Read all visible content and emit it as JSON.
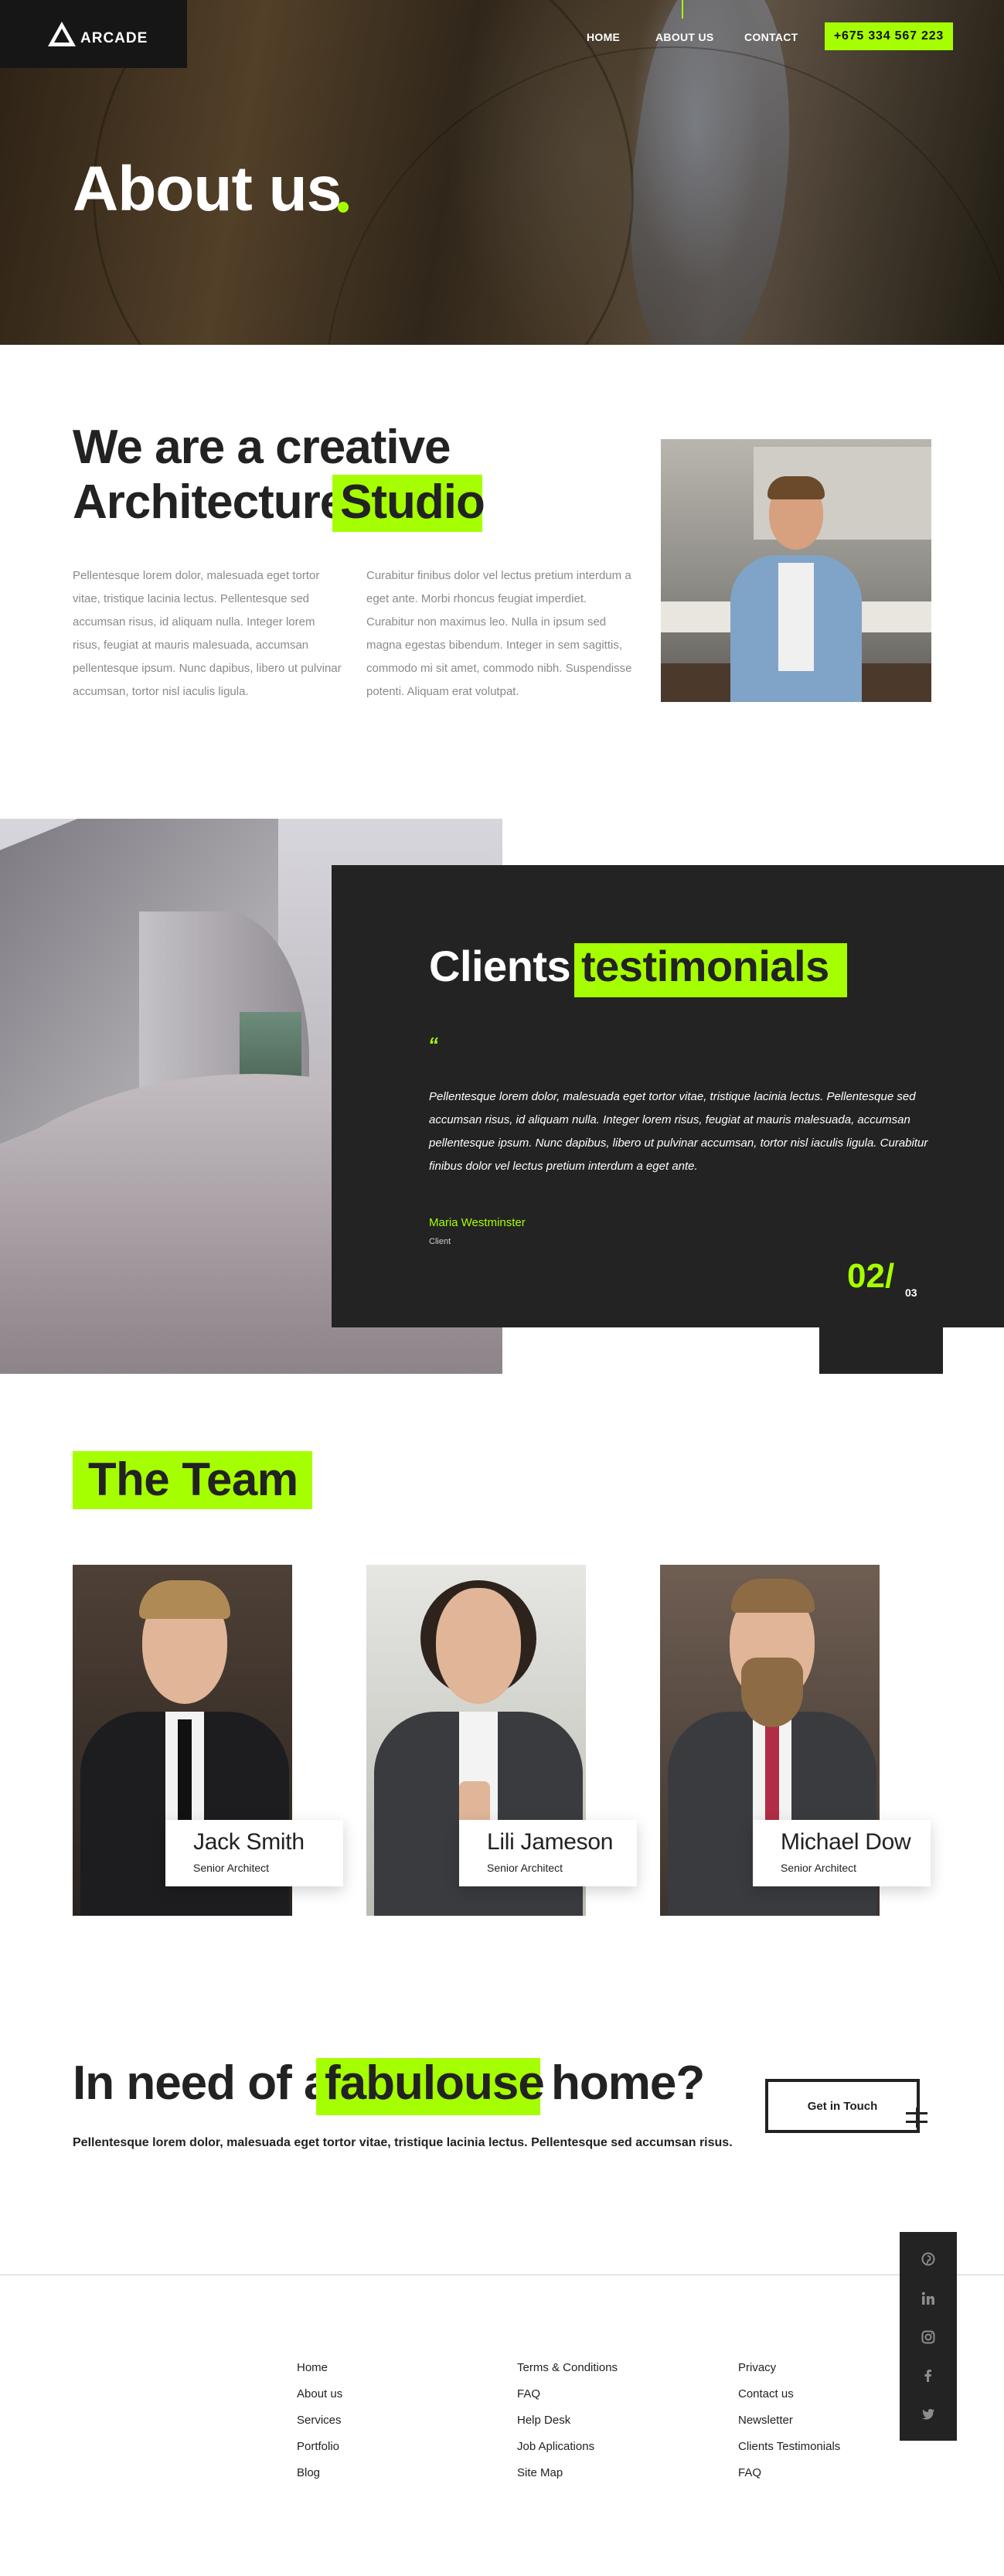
{
  "header": {
    "logo_text": "ARCADE",
    "nav": [
      "HOME",
      "ABOUT US",
      "CONTACT"
    ],
    "phone": "+675 334 567 223",
    "accent": "#a6ff00"
  },
  "hero": {
    "title": "About us"
  },
  "studio": {
    "heading_line1": "We are a creative",
    "heading_line2": "Architecture",
    "heading_highlight": "Studio",
    "para1": "Pellentesque lorem dolor, malesuada eget tortor vitae, tristique lacinia lectus. Pellentesque sed accumsan risus, id aliquam nulla. Integer lorem risus, feugiat at mauris malesuada, accumsan pellentesque ipsum. Nunc dapibus, libero ut pulvinar accumsan, tortor nisl iaculis ligula.",
    "para2": "Curabitur finibus dolor vel lectus pretium interdum a eget ante. Morbi rhoncus feugiat imperdiet. Curabitur non maximus leo. Nulla in ipsum sed magna egestas bibendum. Integer in sem sagittis, commodo mi sit amet, commodo nibh. Suspendisse potenti. Aliquam erat volutpat."
  },
  "testimonials": {
    "heading": "Clients",
    "heading_highlight": "testimonials",
    "quote_mark": "“",
    "text": "Pellentesque lorem dolor, malesuada eget tortor vitae, tristique lacinia lectus. Pellentesque sed accumsan risus, id aliquam nulla. Integer lorem risus, feugiat at mauris malesuada, accumsan pellentesque ipsum. Nunc dapibus, libero ut pulvinar accumsan, tortor nisl iaculis ligula. Curabitur finibus dolor vel lectus pretium interdum a eget ante.",
    "author": "Maria Westminster",
    "role": "Client",
    "current": "02/",
    "total": "03"
  },
  "team": {
    "title": "The Team",
    "members": [
      {
        "name": "Jack Smith",
        "role": "Senior Architect"
      },
      {
        "name": "Lili Jameson",
        "role": "Senior Architect"
      },
      {
        "name": "Michael Dow",
        "role": "Senior Architect"
      }
    ]
  },
  "cta": {
    "pre": "In need of a",
    "highlight": "fabulouse",
    "post": "home?",
    "subtitle": "Pellentesque lorem dolor, malesuada eget tortor vitae, tristique lacinia lectus. Pellentesque sed accumsan risus.",
    "button": "Get in Touch"
  },
  "social": [
    "pinterest-icon",
    "linkedin-icon",
    "instagram-icon",
    "facebook-icon",
    "twitter-icon"
  ],
  "footer": {
    "col1": [
      "Home",
      "About us",
      "Services",
      "Portfolio",
      "Blog"
    ],
    "col2": [
      "Terms & Conditions",
      "FAQ",
      "Help Desk",
      "Job Aplications",
      "Site Map"
    ],
    "col3": [
      "Privacy",
      "Contact us",
      "Newsletter",
      "Clients Testimonials",
      "FAQ"
    ]
  }
}
